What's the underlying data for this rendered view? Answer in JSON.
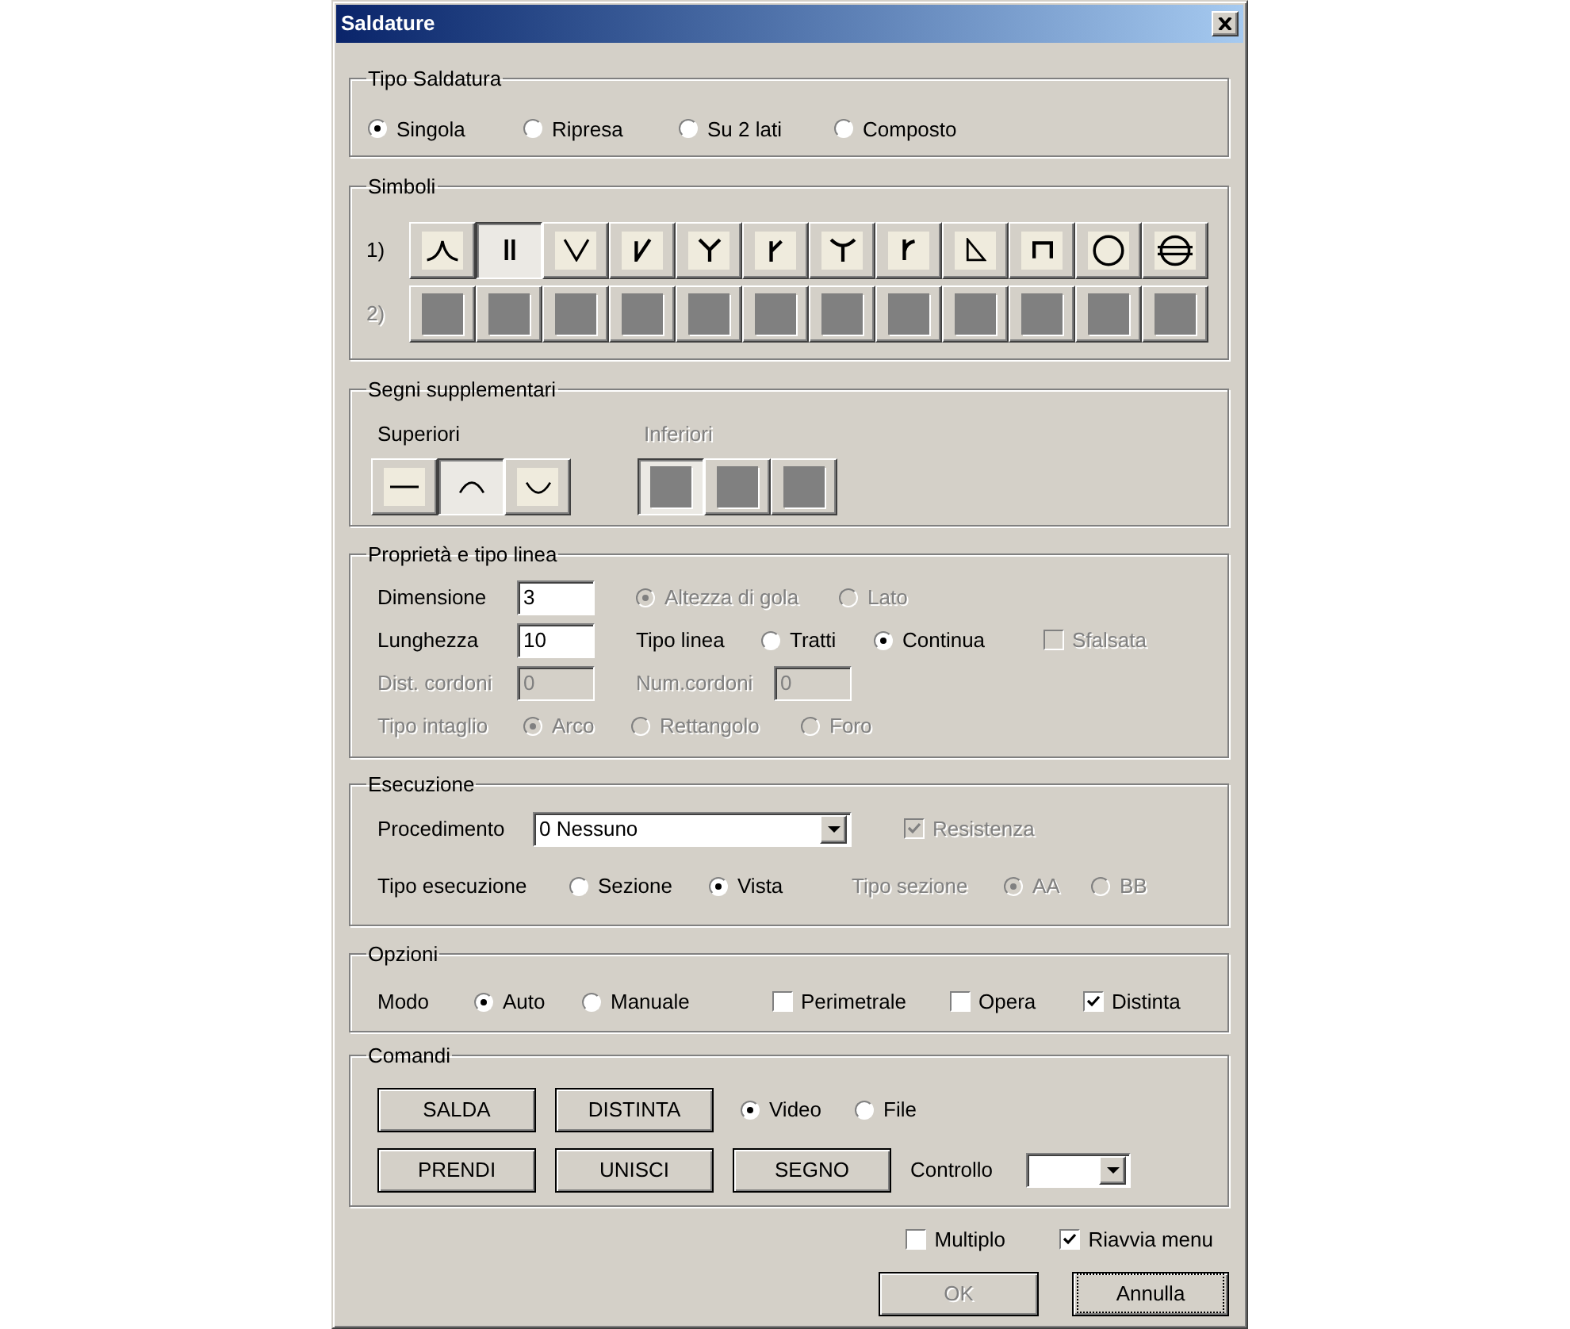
{
  "window": {
    "title": "Saldature"
  },
  "tipo_saldatura": {
    "title": "Tipo Saldatura",
    "options": [
      {
        "label": "Singola",
        "selected": true
      },
      {
        "label": "Ripresa",
        "selected": false
      },
      {
        "label": "Su 2 lati",
        "selected": false
      },
      {
        "label": "Composto",
        "selected": false
      }
    ]
  },
  "simboli": {
    "title": "Simboli",
    "rows": [
      {
        "label": "1)",
        "disabled": false,
        "buttons": [
          {
            "kind": "flare",
            "selected": false
          },
          {
            "kind": "square",
            "selected": true
          },
          {
            "kind": "v",
            "selected": false
          },
          {
            "kind": "bevel",
            "selected": false
          },
          {
            "kind": "y",
            "selected": false
          },
          {
            "kind": "bevel_y",
            "selected": false
          },
          {
            "kind": "u",
            "selected": false
          },
          {
            "kind": "j",
            "selected": false
          },
          {
            "kind": "fillet",
            "selected": false
          },
          {
            "kind": "plug",
            "selected": false
          },
          {
            "kind": "spot",
            "selected": false
          },
          {
            "kind": "seam",
            "selected": false
          }
        ]
      },
      {
        "label": "2)",
        "disabled": true,
        "buttons": [
          {
            "kind": "blank",
            "selected": false
          },
          {
            "kind": "blank",
            "selected": false
          },
          {
            "kind": "blank",
            "selected": false
          },
          {
            "kind": "blank",
            "selected": false
          },
          {
            "kind": "blank",
            "selected": false
          },
          {
            "kind": "blank",
            "selected": false
          },
          {
            "kind": "blank",
            "selected": false
          },
          {
            "kind": "blank",
            "selected": false
          },
          {
            "kind": "blank",
            "selected": false
          },
          {
            "kind": "blank",
            "selected": false
          },
          {
            "kind": "blank",
            "selected": false
          },
          {
            "kind": "blank",
            "selected": false
          }
        ]
      }
    ]
  },
  "segni": {
    "title": "Segni supplementari",
    "groups": [
      {
        "label": "Superiori",
        "disabled": false,
        "buttons": [
          {
            "kind": "flat",
            "selected": false
          },
          {
            "kind": "convex",
            "selected": true
          },
          {
            "kind": "concave",
            "selected": false
          }
        ]
      },
      {
        "label": "Inferiori",
        "disabled": true,
        "buttons": [
          {
            "kind": "blank",
            "selected": true
          },
          {
            "kind": "blank",
            "selected": false
          },
          {
            "kind": "blank",
            "selected": false
          }
        ]
      }
    ]
  },
  "proprieta": {
    "title": "Proprietà e tipo linea",
    "dimensione": {
      "label": "Dimensione",
      "value": "3"
    },
    "misura": {
      "disabled": true,
      "options": [
        {
          "label": "Altezza di gola",
          "selected": true
        },
        {
          "label": "Lato",
          "selected": false
        }
      ]
    },
    "lunghezza": {
      "label": "Lunghezza",
      "value": "10"
    },
    "tipo_linea": {
      "label": "Tipo linea",
      "options": [
        {
          "label": "Tratti",
          "selected": false
        },
        {
          "label": "Continua",
          "selected": true
        }
      ]
    },
    "sfalsata": {
      "label": "Sfalsata",
      "checked": false,
      "disabled": true
    },
    "dist_cordoni": {
      "label": "Dist. cordoni",
      "value": "0",
      "disabled": true
    },
    "num_cordoni": {
      "label": "Num.cordoni",
      "value": "0",
      "disabled": true
    },
    "tipo_intaglio": {
      "label": "Tipo intaglio",
      "disabled": true,
      "options": [
        {
          "label": "Arco",
          "selected": true
        },
        {
          "label": "Rettangolo",
          "selected": false
        },
        {
          "label": "Foro",
          "selected": false
        }
      ]
    }
  },
  "esecuzione": {
    "title": "Esecuzione",
    "procedimento": {
      "label": "Procedimento",
      "value": "0 Nessuno"
    },
    "resistenza": {
      "label": "Resistenza",
      "checked": true,
      "disabled": true
    },
    "tipo_esecuzione": {
      "label": "Tipo esecuzione",
      "options": [
        {
          "label": "Sezione",
          "selected": false
        },
        {
          "label": "Vista",
          "selected": true
        }
      ]
    },
    "tipo_sezione": {
      "label": "Tipo sezione",
      "disabled": true,
      "options": [
        {
          "label": "AA",
          "selected": true
        },
        {
          "label": "BB",
          "selected": false
        }
      ]
    }
  },
  "opzioni": {
    "title": "Opzioni",
    "modo": {
      "label": "Modo",
      "options": [
        {
          "label": "Auto",
          "selected": true
        },
        {
          "label": "Manuale",
          "selected": false
        }
      ]
    },
    "checks": [
      {
        "label": "Perimetrale",
        "checked": false
      },
      {
        "label": "Opera",
        "checked": false
      },
      {
        "label": "Distinta",
        "checked": true
      }
    ]
  },
  "comandi": {
    "title": "Comandi",
    "buttons_1": [
      "SALDA",
      "DISTINTA"
    ],
    "output": {
      "options": [
        {
          "label": "Video",
          "selected": true
        },
        {
          "label": "File",
          "selected": false
        }
      ]
    },
    "buttons_2": [
      "PRENDI",
      "UNISCI",
      "SEGNO"
    ],
    "controllo": {
      "label": "Controllo"
    }
  },
  "footer_checks": [
    {
      "label": "Multiplo",
      "checked": false
    },
    {
      "label": "Riavvia menu",
      "checked": true
    }
  ],
  "footer_buttons": [
    {
      "label": "OK",
      "disabled": true,
      "focused": false
    },
    {
      "label": "Annulla",
      "disabled": false,
      "focused": true
    }
  ]
}
